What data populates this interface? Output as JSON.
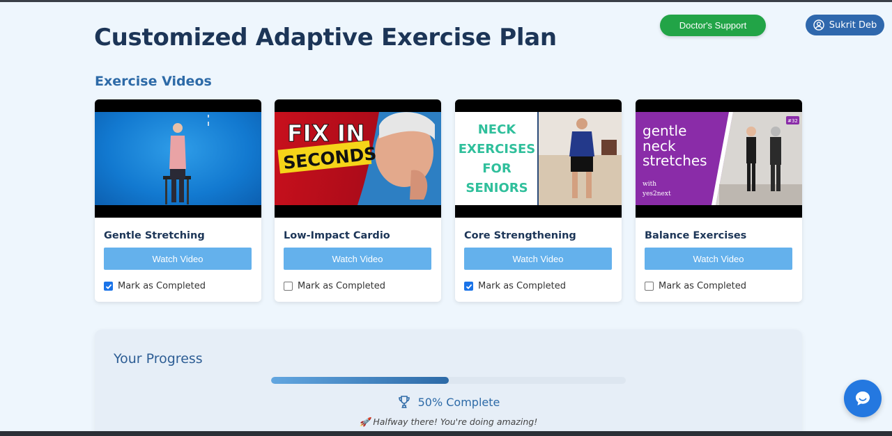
{
  "header": {
    "title": "Customized Adaptive Exercise Plan",
    "doctor_support": "Doctor's Support",
    "user_name": "Sukrit Deb"
  },
  "videos": {
    "section_title": "Exercise Videos",
    "watch_label": "Watch Video",
    "mark_label": "Mark as Completed",
    "items": [
      {
        "title": "Gentle Stretching",
        "completed": true
      },
      {
        "title": "Low-Impact Cardio",
        "completed": false,
        "thumb_text_1": "FIX IN",
        "thumb_text_2": "SECONDS"
      },
      {
        "title": "Core Strengthening",
        "completed": true,
        "thumb_text": "NECK EXERCISES FOR SENIORS"
      },
      {
        "title": "Balance Exercises",
        "completed": false,
        "thumb_text": "gentle neck stretches",
        "thumb_sub": "with yes2next",
        "thumb_badge": "#32"
      }
    ]
  },
  "progress": {
    "title": "Your Progress",
    "percent": 50,
    "percent_label": "50% Complete",
    "message": "Halfway there! You're doing amazing!",
    "message_icon": "rocket-icon"
  },
  "colors": {
    "accent": "#2d6aa7",
    "doctor_button": "#22a447",
    "watch_button": "#64b1ec",
    "chat_button": "#2478e0"
  }
}
